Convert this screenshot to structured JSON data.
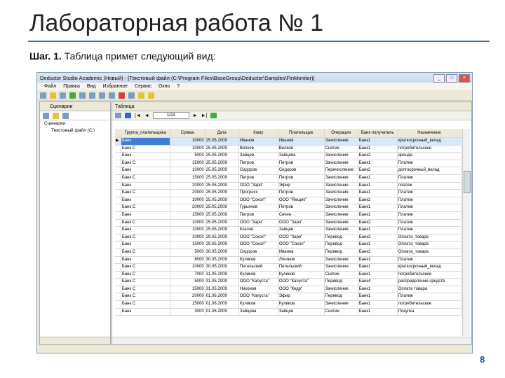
{
  "slide": {
    "title": "Лабораторная работа № 1",
    "step_bold": "Шаг. 1.",
    "step_text": " Таблица примет следующий вид:",
    "page": "8"
  },
  "window": {
    "title": "Deductor Studio Academic (Новый) - [Текстовый файл (C:\\Program Files\\BaseGroup\\Deductor\\Samples\\FinMonitor)]",
    "menu": [
      "Файл",
      "Правка",
      "Вид",
      "Избранное",
      "Сервис",
      "Окно",
      "?"
    ],
    "left_panel": "Сценарии",
    "tree": [
      "Сценарии",
      "Текстовый файл (C:\\"
    ],
    "right_panel": "Таблица",
    "record": "1/24"
  },
  "table": {
    "columns": [
      "Группа_плательщика",
      "Сумма",
      "Дата",
      "Кому",
      "Плательщик",
      "Операция",
      "Банк получатель",
      "Назначение"
    ],
    "rows": [
      [
        "Банк",
        "10000",
        "25.05.2009",
        "Иванов",
        "Иванов",
        "Зачисление",
        "Банк1",
        "краткосрочный_вклад"
      ],
      [
        "Банк С",
        "10000",
        "25.05.2009",
        "Волков",
        "Волков",
        "Снятие",
        "Банк1",
        "потребительские"
      ],
      [
        "Банк",
        "5000",
        "25.05.2009",
        "Зайцев",
        "Зайцева",
        "Зачисление",
        "Банк2",
        "аренда"
      ],
      [
        "Банк С",
        "15000",
        "25.05.2009",
        "Петров",
        "Петров",
        "Зачисление",
        "Банк1",
        "Платеж"
      ],
      [
        "Банк",
        "10000",
        "25.05.2009",
        "Сидоров",
        "Сидоров",
        "Перечисление",
        "Банк2",
        "долгосрочный_вклад"
      ],
      [
        "Банк С",
        "15000",
        "25.05.2009",
        "Петров",
        "Петров",
        "Зачисление",
        "Банк1",
        "Платеж"
      ],
      [
        "Банк",
        "20000",
        "25.05.2009",
        "ООО \"Заря\"",
        "Эфир",
        "Зачисление",
        "Банк1",
        "платеж"
      ],
      [
        "Банк С",
        "20000",
        "25.05.2009",
        "Прогресс",
        "Петров",
        "Зачисление",
        "Банк1",
        "Платеж"
      ],
      [
        "Банк",
        "10000",
        "25.05.2009",
        "ООО \"Сокол\"",
        "ООО \"Ямщик\"",
        "Зачисление",
        "Банк2",
        "Платеж"
      ],
      [
        "Банк С",
        "20000",
        "25.05.2009",
        "Гурьянов",
        "Петров",
        "Зачисление",
        "Банк1",
        "Платеж"
      ],
      [
        "Банк",
        "15000",
        "25.05.2009",
        "Петров",
        "Сечин",
        "Зачисление",
        "Банк1",
        "Платеж"
      ],
      [
        "Банк С",
        "10000",
        "25.05.2009",
        "ООО \"Заря\"",
        "ООО \"Заря\"",
        "Зачисление",
        "Банк2",
        "Платеж"
      ],
      [
        "Банк",
        "10000",
        "25.05.2009",
        "Козлов",
        "Зайцев",
        "Зачисление",
        "Банк1",
        "Платеж"
      ],
      [
        "Банк С",
        "10000",
        "29.05.2009",
        "ООО \"Сокол\"",
        "ООО \"Заря\"",
        "Перевод",
        "Банк2",
        "Оплата_товара"
      ],
      [
        "Банк",
        "15000",
        "29.05.2009",
        "ООО \"Сокол\"",
        "ООО \"Сокол\"",
        "Перевод",
        "Банк1",
        "Оплата_товара"
      ],
      [
        "Банк С",
        "5000",
        "30.05.2009",
        "Сидоров",
        "Иванов",
        "Перевод",
        "Банк2",
        "Оплата_товара"
      ],
      [
        "Банк",
        "8000",
        "30.05.2009",
        "Куликов",
        "Логинов",
        "Зачисление",
        "Банк1",
        "Платеж"
      ],
      [
        "Банк С",
        "10000",
        "30.05.2009",
        "Петельский",
        "Петельский",
        "Зачисление",
        "Банк1",
        "краткосрочный_вклад"
      ],
      [
        "Банк С",
        "7000",
        "31.05.2009",
        "Куликов",
        "Куликов",
        "Снятие",
        "Банк1",
        "потребительские"
      ],
      [
        "Банк С",
        "5000",
        "31.05.2009",
        "ООО \"Капуста\"",
        "ООО \"Капуста\"",
        "Перевод",
        "Банк4",
        "распределение средств"
      ],
      [
        "Банк С",
        "15000",
        "31.05.2009",
        "Никонов",
        "ООО \"Кедр\"",
        "Зачисление",
        "Банк1",
        "Оплата товара"
      ],
      [
        "Банк С",
        "20000",
        "01.06.2009",
        "ООО \"Капуста\"",
        "Эфир",
        "Перевод",
        "Банк1",
        "Платеж"
      ],
      [
        "Банк С",
        "15000",
        "01.06.2009",
        "Куликов",
        "Куликов",
        "Зачисление",
        "Банк1",
        "потребительские"
      ],
      [
        "Банк",
        "3000",
        "01.06.2009",
        "Зайцева",
        "Зайцев",
        "Снятие",
        "Банк1",
        "Покупка"
      ]
    ]
  }
}
